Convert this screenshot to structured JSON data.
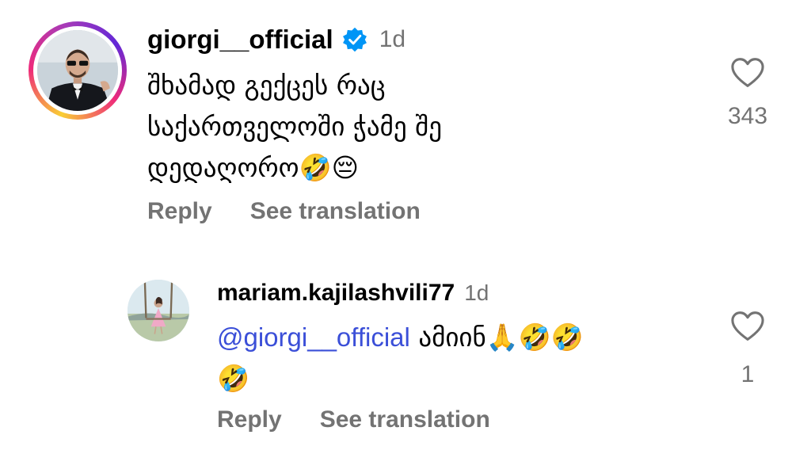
{
  "comments": [
    {
      "username": "giorgi__official",
      "verified": true,
      "time": "1d",
      "text_lines": [
        "შხამად გექცეს რაც",
        "საქართველოში ჭამე შე",
        "დედაღორო🤣😔"
      ],
      "reply_label": "Reply",
      "translate_label": "See translation",
      "like_count": "343",
      "avatar_icon": "profile-photo-man-in-tuxedo"
    },
    {
      "username": "mariam.kajilashvili77",
      "verified": false,
      "time": "1d",
      "mention": "@giorgi__official",
      "text_lines": [
        " ამიინ🙏🤣🤣",
        "🤣"
      ],
      "reply_label": "Reply",
      "translate_label": "See translation",
      "like_count": "1",
      "avatar_icon": "profile-photo-woman-on-swing"
    }
  ],
  "colors": {
    "verified_badge": "#0095f6",
    "secondary_text": "#737373",
    "mention": "#3b4fd8"
  }
}
